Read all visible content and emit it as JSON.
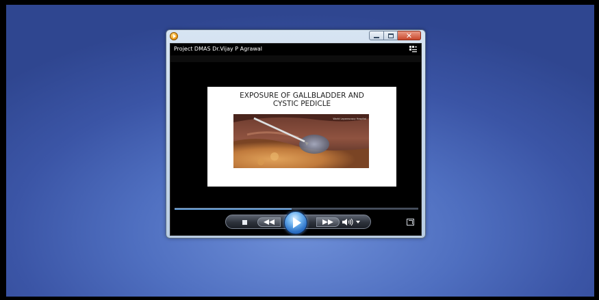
{
  "player": {
    "title": "Project DMAS Dr.Vijay P Agrawal",
    "playback_progress": 0.48,
    "icons": {
      "app": "windows-media-player-icon",
      "switch_view": "switch-to-library-icon",
      "stop": "stop-icon",
      "rewind": "rewind-icon",
      "play": "play-icon",
      "fast_forward": "fast-forward-icon",
      "volume": "volume-icon",
      "volume_menu": "chevron-down-icon",
      "fullscreen": "fullscreen-icon"
    }
  },
  "slide": {
    "title": "EXPOSURE OF GALLBLADDER AND\nCYSTIC PEDICLE",
    "image_watermark": "World Laparoscopy Hospital"
  },
  "window": {
    "caption_minimize": "minimize-icon",
    "caption_maximize": "maximize-icon",
    "caption_close": "close-icon",
    "close_glyph": "✕"
  },
  "colors": {
    "desktop_background": "#4f6fc0",
    "player_background": "#000000",
    "seek_fill": "#4b8fd8",
    "play_button": "#2b6fc4"
  }
}
